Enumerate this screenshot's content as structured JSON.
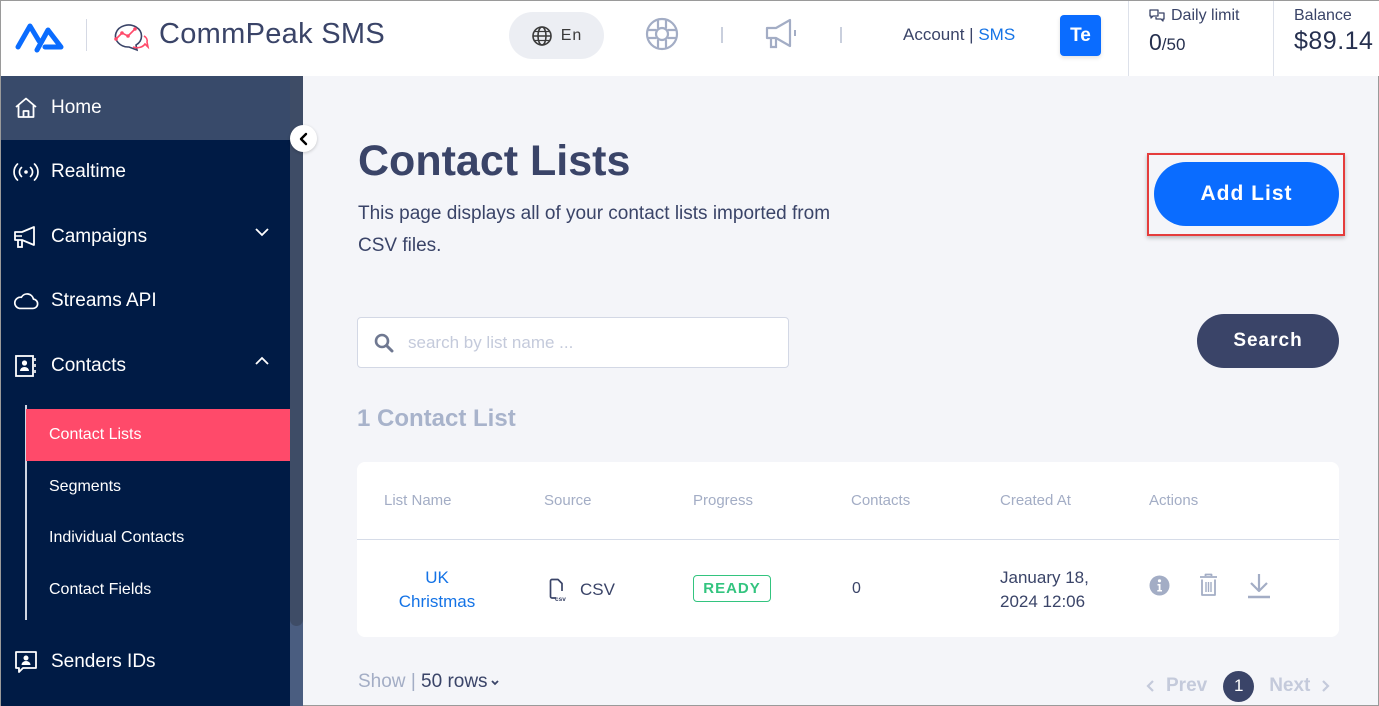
{
  "header": {
    "brand_name": "CommPeak SMS",
    "language": "En",
    "account_label": "Account",
    "account_separator": "|",
    "account_product": "SMS",
    "avatar_initials": "Te",
    "daily_limit": {
      "label": "Daily limit",
      "used": "0",
      "total": "/50"
    },
    "balance": {
      "label": "Balance",
      "value": "$89.14"
    }
  },
  "sidebar": {
    "items": [
      {
        "label": "Home",
        "icon": "home-icon",
        "active": true
      },
      {
        "label": "Realtime",
        "icon": "broadcast-icon"
      },
      {
        "label": "Campaigns",
        "icon": "megaphone-icon",
        "expandable": true,
        "expanded": false
      },
      {
        "label": "Streams API",
        "icon": "cloud-icon"
      },
      {
        "label": "Contacts",
        "icon": "contacts-book-icon",
        "expandable": true,
        "expanded": true
      },
      {
        "label": "Senders IDs",
        "icon": "sender-id-icon"
      }
    ],
    "contacts_submenu": [
      {
        "label": "Contact Lists",
        "active": true
      },
      {
        "label": "Segments"
      },
      {
        "label": "Individual Contacts"
      },
      {
        "label": "Contact Fields"
      }
    ]
  },
  "main": {
    "title": "Contact Lists",
    "description": "This page displays all of your contact lists imported from CSV files.",
    "add_button": "Add List",
    "search": {
      "placeholder": "search by list name ...",
      "value": "",
      "button": "Search"
    },
    "count_label": "1 Contact List",
    "table": {
      "columns": [
        "List Name",
        "Source",
        "Progress",
        "Contacts",
        "Created At",
        "Actions"
      ],
      "rows": [
        {
          "list_name_line1": "UK",
          "list_name_line2": "Christmas",
          "source": "CSV",
          "progress": "READY",
          "contacts": "0",
          "created_line1": "January 18,",
          "created_line2": "2024 12:06",
          "actions": [
            "info-icon",
            "trash-icon",
            "download-icon"
          ]
        }
      ]
    },
    "footer": {
      "show_label": "Show",
      "separator": "|",
      "rows_value": "50 rows",
      "prev": "Prev",
      "next": "Next",
      "current_page": "1"
    }
  },
  "colors": {
    "primary_blue": "#0a6cff",
    "sidebar_bg": "#001b45",
    "active_item": "#ff4a6a",
    "text_dark": "#3a4468",
    "ready_green": "#33c47f",
    "highlight_red": "#e53c3c"
  }
}
